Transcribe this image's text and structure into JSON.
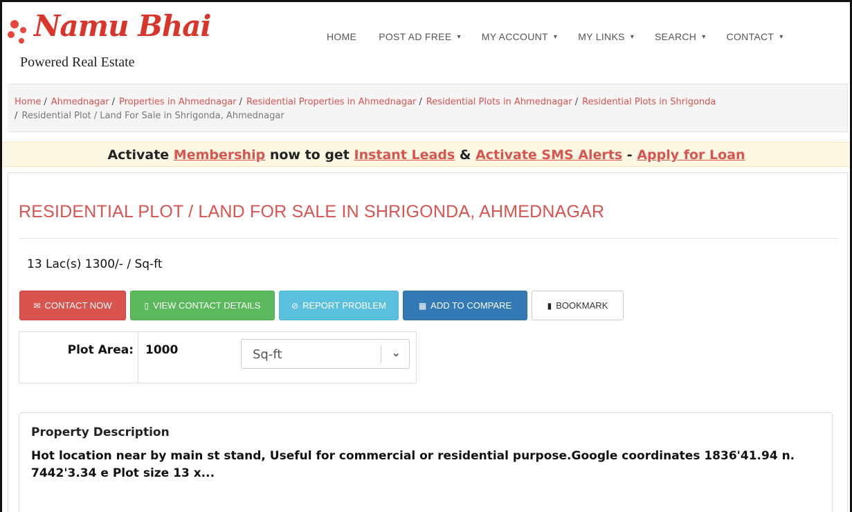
{
  "brand": {
    "logo_text": "Namu Bhai",
    "tagline": "Powered Real Estate",
    "accent_color": "#d9534f"
  },
  "nav": {
    "items": [
      {
        "label": "HOME",
        "has_dropdown": false
      },
      {
        "label": "POST AD FREE",
        "has_dropdown": true
      },
      {
        "label": "MY ACCOUNT",
        "has_dropdown": true
      },
      {
        "label": "MY LINKS",
        "has_dropdown": true
      },
      {
        "label": "SEARCH",
        "has_dropdown": true
      },
      {
        "label": "CONTACT",
        "has_dropdown": true
      }
    ]
  },
  "breadcrumb": {
    "links": [
      "Home",
      "Ahmednagar",
      "Properties in Ahmednagar",
      "Residential Properties in Ahmednagar",
      "Residential Plots in Ahmednagar",
      "Residential Plots in Shrigonda"
    ],
    "current": "Residential Plot / Land For Sale in Shrigonda, Ahmednagar"
  },
  "alert": {
    "t1": "Activate ",
    "membership": "Membership",
    "t2": " now to get ",
    "leads": "Instant Leads",
    "t3": " & ",
    "sms": "Activate SMS Alerts",
    "t4": " - ",
    "loan": "Apply for Loan"
  },
  "listing": {
    "title": "RESIDENTIAL PLOT / LAND FOR SALE IN SHRIGONDA, AHMEDNAGAR",
    "price": "13 Lac(s) 1300/- / Sq-ft"
  },
  "actions": {
    "contact_now": "CONTACT NOW",
    "view_contact": "VIEW CONTACT DETAILS",
    "report_problem": "REPORT PROBLEM",
    "add_compare": "ADD TO COMPARE",
    "bookmark": "BOOKMARK"
  },
  "plot": {
    "label": "Plot Area:",
    "value": "1000",
    "unit_selected": "Sq-ft"
  },
  "description": {
    "heading": "Property Description",
    "body": "Hot location near by main st stand, Useful for commercial or residential purpose.Google coordinates 1836'41.94 n. 7442'3.34 e Plot size 13 x..."
  }
}
